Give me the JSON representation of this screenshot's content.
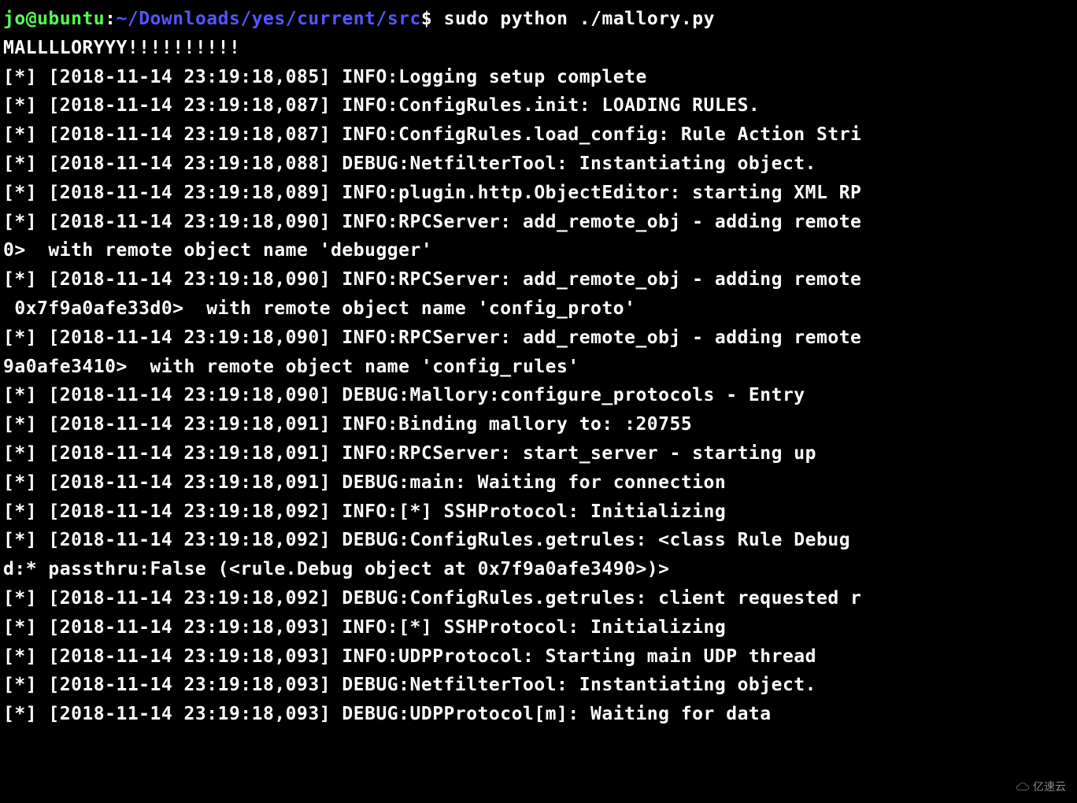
{
  "prompt": {
    "user": "jo",
    "host": "ubuntu",
    "path": "~/Downloads/yes/current/src",
    "sep_userhost": "@",
    "sep_hostpath": ":",
    "end": "$",
    "command": "sudo python ./mallory.py"
  },
  "banner": "MALLLLORYYY!!!!!!!!!!",
  "log_lines": [
    "[*] [2018-11-14 23:19:18,085] INFO:Logging setup complete",
    "[*] [2018-11-14 23:19:18,087] INFO:ConfigRules.init: LOADING RULES.",
    "[*] [2018-11-14 23:19:18,087] INFO:ConfigRules.load_config: Rule Action Stri",
    "[*] [2018-11-14 23:19:18,088] DEBUG:NetfilterTool: Instantiating object.",
    "[*] [2018-11-14 23:19:18,089] INFO:plugin.http.ObjectEditor: starting XML RP",
    "[*] [2018-11-14 23:19:18,090] INFO:RPCServer: add_remote_obj - adding remote",
    "0>  with remote object name 'debugger'",
    "[*] [2018-11-14 23:19:18,090] INFO:RPCServer: add_remote_obj - adding remote",
    " 0x7f9a0afe33d0>  with remote object name 'config_proto'",
    "[*] [2018-11-14 23:19:18,090] INFO:RPCServer: add_remote_obj - adding remote",
    "9a0afe3410>  with remote object name 'config_rules'",
    "[*] [2018-11-14 23:19:18,090] DEBUG:Mallory:configure_protocols - Entry",
    "[*] [2018-11-14 23:19:18,091] INFO:Binding mallory to: :20755",
    "[*] [2018-11-14 23:19:18,091] INFO:RPCServer: start_server - starting up",
    "[*] [2018-11-14 23:19:18,091] DEBUG:main: Waiting for connection",
    "[*] [2018-11-14 23:19:18,092] INFO:[*] SSHProtocol: Initializing",
    "[*] [2018-11-14 23:19:18,092] DEBUG:ConfigRules.getrules: <class Rule Debug ",
    "d:* passthru:False (<rule.Debug object at 0x7f9a0afe3490>)>",
    "[*] [2018-11-14 23:19:18,092] DEBUG:ConfigRules.getrules: client requested r",
    "[*] [2018-11-14 23:19:18,093] INFO:[*] SSHProtocol: Initializing",
    "[*] [2018-11-14 23:19:18,093] INFO:UDPProtocol: Starting main UDP thread",
    "[*] [2018-11-14 23:19:18,093] DEBUG:NetfilterTool: Instantiating object.",
    "[*] [2018-11-14 23:19:18,093] DEBUG:UDPProtocol[m]: Waiting for data"
  ],
  "watermark": "亿速云"
}
